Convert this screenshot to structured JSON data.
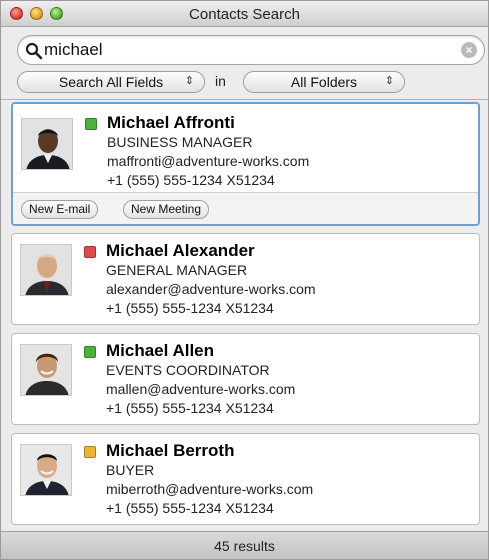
{
  "window": {
    "title": "Contacts Search"
  },
  "search": {
    "value": "michael"
  },
  "filters": {
    "field_scope": "Search All Fields",
    "in_label": "in",
    "folder_scope": "All Folders"
  },
  "contacts": [
    {
      "name": "Michael Affronti",
      "title": "BUSINESS MANAGER",
      "email": "maffronti@adventure-works.com",
      "phone": "+1 (555) 555-1234 X51234",
      "status_color": "#4bb33c",
      "selected": true
    },
    {
      "name": "Michael Alexander",
      "title": "GENERAL MANAGER",
      "email": "alexander@adventure-works.com",
      "phone": "+1 (555) 555-1234 X51234",
      "status_color": "#e04a4a"
    },
    {
      "name": "Michael Allen",
      "title": "EVENTS COORDINATOR",
      "email": "mallen@adventure-works.com",
      "phone": "+1 (555) 555-1234 X51234",
      "status_color": "#4bb33c"
    },
    {
      "name": "Michael Berroth",
      "title": "BUYER",
      "email": "miberroth@adventure-works.com",
      "phone": "+1 (555) 555-1234 X51234",
      "status_color": "#f0b233"
    }
  ],
  "card_actions": {
    "new_email": "New E-mail",
    "new_meeting": "New Meeting"
  },
  "status_bar": {
    "results": "45 results"
  },
  "icons": {
    "search": "search-icon",
    "clear": "clear-icon"
  }
}
